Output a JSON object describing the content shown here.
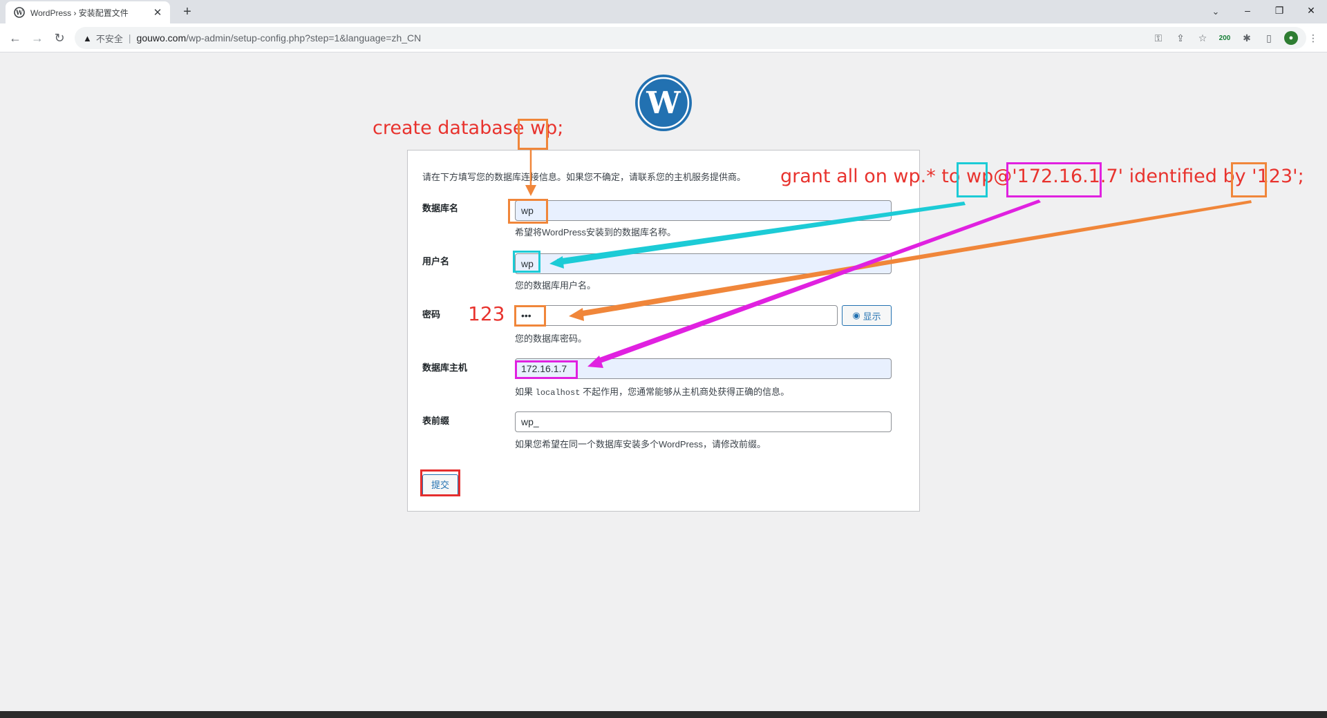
{
  "browser": {
    "tab_title": "WordPress › 安装配置文件",
    "new_tab": "+",
    "url_warning": "不安全",
    "url_host": "gouwo.com",
    "url_path": "/wp-admin/setup-config.php?step=1&language=zh_CN",
    "ext_badge": "200",
    "window_controls": [
      "minimize",
      "restore",
      "close"
    ]
  },
  "form": {
    "intro": "请在下方填写您的数据库连接信息。如果您不确定，请联系您的主机服务提供商。",
    "dbname_label": "数据库名",
    "dbname_value": "wp",
    "dbname_desc": "希望将WordPress安装到的数据库名称。",
    "user_label": "用户名",
    "user_value": "wp",
    "user_desc": "您的数据库用户名。",
    "pass_label": "密码",
    "pass_value": "•••",
    "pass_show": "显示",
    "pass_desc": "您的数据库密码。",
    "host_label": "数据库主机",
    "host_value": "172.16.1.7",
    "host_desc_pre": "如果",
    "host_desc_code": "localhost",
    "host_desc_post": "不起作用，您通常能够从主机商处获得正确的信息。",
    "prefix_label": "表前缀",
    "prefix_value": "wp_",
    "prefix_desc": "如果您希望在同一个数据库安装多个WordPress，请修改前缀。",
    "submit": "提交"
  },
  "annotations": {
    "create_pre": "create database ",
    "create_wp": "wp",
    "create_post": ";",
    "grant_pre": "grant all on wp.* to ",
    "grant_user": "wp",
    "grant_at": "@'",
    "grant_host": "172.16.1.7",
    "grant_mid": "' identified by '",
    "grant_pass": "123",
    "grant_post": "';",
    "password_note": "123",
    "colors": {
      "text": "#e8332e",
      "orange": "#f0863a",
      "cyan": "#1ccbd6",
      "magenta": "#e021e0",
      "red": "#e52d2d"
    }
  }
}
